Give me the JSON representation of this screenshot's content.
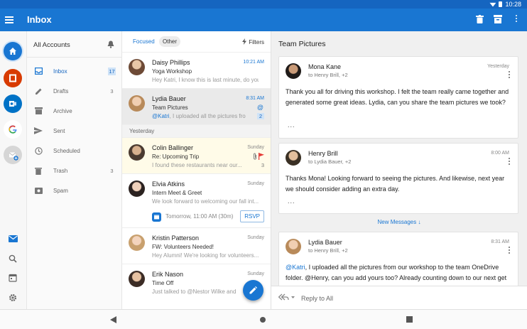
{
  "status_bar": {
    "time": "10:28"
  },
  "app_bar": {
    "title": "Inbox"
  },
  "colors": {
    "brand": "#1976d2",
    "status": "#1565c0",
    "flag": "#e53935",
    "office": "#d83b01",
    "outlook": "#0072c6"
  },
  "rail": {
    "icons": [
      "home-icon",
      "office-icon",
      "outlook-icon",
      "google-icon",
      "add-account-icon",
      "mail-icon",
      "search-icon",
      "calendar-icon",
      "settings-icon"
    ]
  },
  "folders": {
    "account_label": "All Accounts",
    "items": [
      {
        "label": "Inbox",
        "count": "17",
        "icon": "inbox-icon"
      },
      {
        "label": "Drafts",
        "count": "3",
        "icon": "drafts-icon"
      },
      {
        "label": "Archive",
        "count": "",
        "icon": "archive-icon"
      },
      {
        "label": "Sent",
        "count": "",
        "icon": "sent-icon"
      },
      {
        "label": "Scheduled",
        "count": "",
        "icon": "scheduled-icon"
      },
      {
        "label": "Trash",
        "count": "3",
        "icon": "trash-icon"
      },
      {
        "label": "Spam",
        "count": "",
        "icon": "spam-icon"
      }
    ]
  },
  "list": {
    "tab_focused": "Focused",
    "tab_other": "Other",
    "filters_label": "Filters",
    "section_yesterday": "Yesterday",
    "messages": [
      {
        "from": "Daisy Phillips",
        "time": "10:21 AM",
        "subject": "Yoga Workshop",
        "preview": "Hey Katri, I know this is last minute, do you",
        "count": ""
      },
      {
        "from": "Lydia Bauer",
        "time": "8:31 AM",
        "subject": "Team Pictures",
        "mention": "@Katri",
        "preview": ", I uploaded all the pictures fro",
        "count": "2"
      },
      {
        "from": "Colin Ballinger",
        "time": "Sunday",
        "subject": "Re: Upcoming Trip",
        "preview": "I found these restaurants near our...",
        "count": "3"
      },
      {
        "from": "Elvia Atkins",
        "time": "Sunday",
        "subject": "Intern Meet & Greet",
        "preview": "We look forward to welcoming our fall int...",
        "event": "Tomorrow, 11:00 AM (30m)",
        "rsvp": "RSVP"
      },
      {
        "from": "Kristin Patterson",
        "time": "Sunday",
        "subject": "FW: Volunteers Needed!",
        "preview": "Hey Alumni! We're looking for volunteers...",
        "count": ""
      },
      {
        "from": "Erik Nason",
        "time": "Sunday",
        "subject": "Time Off",
        "preview": "Just talked to @Nestor Wilke and he",
        "count": ""
      }
    ]
  },
  "reader": {
    "title": "Team Pictures",
    "messages": [
      {
        "from": "Mona Kane",
        "to": "to Henry Brill, +2",
        "time": "Yesterday",
        "body": "Thank you all for driving this workshop. I felt the team really came together and generated some great ideas. Lydia, can you share the team pictures we took?",
        "dots": "..."
      },
      {
        "from": "Henry Brill",
        "to": "to Lydia Bauer, +2",
        "time": "8:00 AM",
        "body": "Thanks Mona! Looking forward to seeing the pictures. And likewise, next year we should consider adding an extra day.",
        "dots": "..."
      },
      {
        "from": "Lydia Bauer",
        "to": "to Henry Brill, +2",
        "time": "8:31 AM",
        "mention1": "@Katri",
        "body_part1": ", I uploaded all the pictures from our workshop to the team OneDrive folder. ",
        "mention2": "@Henry",
        "body_part2": ", can you add yours too? Already counting down to our next get together!"
      }
    ],
    "new_messages_label": "New Messages ↓",
    "reply_placeholder": "Reply to All"
  }
}
